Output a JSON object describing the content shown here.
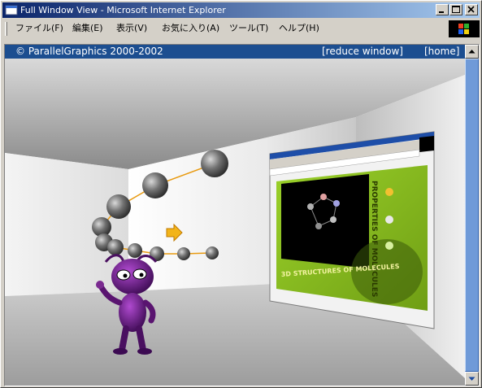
{
  "window": {
    "title": "Full Window View - Microsoft Internet Explorer"
  },
  "menu": {
    "items": [
      "ファイル(F)",
      "編集(E)",
      "表示(V)",
      "お気に入り(A)",
      "ツール(T)",
      "ヘルプ(H)"
    ]
  },
  "viewer": {
    "copyright": "© ParallelGraphics 2000-2002",
    "reduce_link": "[reduce window]",
    "home_link": "[home]"
  },
  "panel": {
    "vertical_title": "PROPERTIES OF MOLECULES",
    "banner": "3D STRUCTURES OF MOLECULES"
  },
  "colors": {
    "title_gradient_start": "#0a246a",
    "title_gradient_end": "#a6caf0",
    "viewer_bar": "#1c4e90",
    "panel_green": "#8cc21f",
    "creature_purple": "#6d1a83",
    "molecule_gray": "#6b6b6b",
    "bond_orange": "#e89a10",
    "scrollbar_thumb": "#6f9ad8"
  }
}
